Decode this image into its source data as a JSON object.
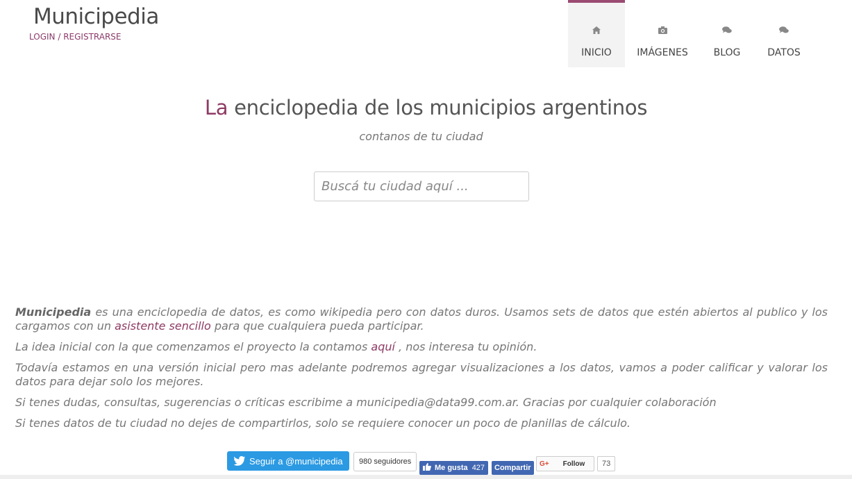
{
  "header": {
    "brand": "Municipedia",
    "login_link": "LOGIN / REGISTRARSE"
  },
  "nav": [
    {
      "label": "INICIO",
      "icon": "home-icon",
      "active": true
    },
    {
      "label": "IMÁGENES",
      "icon": "camera-icon",
      "active": false
    },
    {
      "label": "BLOG",
      "icon": "comments-icon",
      "active": false
    },
    {
      "label": "DATOS",
      "icon": "comments-icon",
      "active": false
    }
  ],
  "hero": {
    "headline_accent": "La",
    "headline_rest": "enciclopedia de los municipios argentinos",
    "tagline": "contanos de tu ciudad",
    "search_placeholder": "Buscá tu ciudad aquí ..."
  },
  "about": {
    "p1_bold": "Municipedia",
    "p1_text_a": "es una enciclopedia de datos, es como wikipedia pero con datos duros. Usamos sets de datos que estén abiertos al publico y los cargamos con un",
    "p1_link": "asistente sencillo",
    "p1_text_b": "para que cualquiera pueda participar.",
    "p2_text_a": "La idea inicial con la que comenzamos el proyecto la contamos",
    "p2_link": "aquí",
    "p2_text_b": ", nos interesa tu opinión.",
    "p3": "Todavía estamos en una versión inicial pero mas adelante podremos agregar visualizaciones a los datos, vamos a poder calificar y valorar los datos para dejar solo los mejores.",
    "p4": "Si tenes dudas, consultas, sugerencias o críticas escribime a municipedia@data99.com.ar. Gracias por cualquier colaboración",
    "p5": "Si tenes datos de tu ciudad no dejes de compartirlos, solo se requiere conocer un poco de planillas de cálculo."
  },
  "social": {
    "twitter_label": "Seguir a @municipedia",
    "twitter_count": "980 seguidores",
    "fb_like_label": "Me gusta",
    "fb_like_count": "427",
    "fb_share_label": "Compartir",
    "gplus_label": "Follow",
    "gplus_g": "G+",
    "gplus_count": "73"
  },
  "colors": {
    "accent": "#8e3a64",
    "twitter": "#2b9ae3",
    "facebook": "#4267b2"
  }
}
